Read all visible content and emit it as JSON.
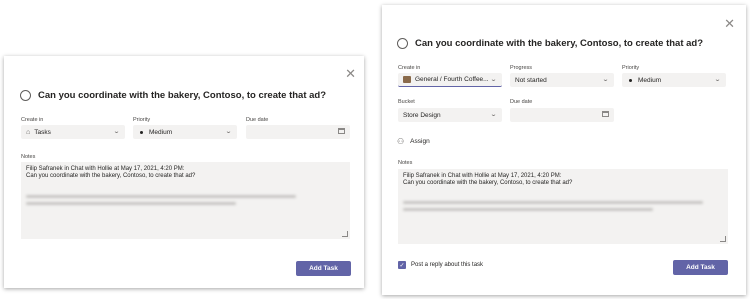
{
  "left_dialog": {
    "close_glyph": "✕",
    "title": "Can you coordinate with the bakery, Contoso, to create that ad?",
    "create_in_label": "Create in",
    "create_in_value": "Tasks",
    "priority_label": "Priority",
    "priority_value": "Medium",
    "due_date_label": "Due date",
    "notes_label": "Notes",
    "notes_line1": "Filip Safranek in Chat with Hollie at May 17, 2021, 4:20 PM:",
    "notes_line2": "Can you coordinate with the bakery, Contoso, to create that ad?",
    "add_task_label": "Add Task"
  },
  "right_dialog": {
    "close_glyph": "✕",
    "title": "Can you coordinate with the bakery, Contoso, to create that ad?",
    "create_in_label": "Create in",
    "create_in_value": "General / Fourth Coffee...",
    "progress_label": "Progress",
    "progress_value": "Not started",
    "priority_label": "Priority",
    "priority_value": "Medium",
    "bucket_label": "Bucket",
    "bucket_value": "Store Design",
    "due_date_label": "Due date",
    "assign_label": "Assign",
    "notes_label": "Notes",
    "notes_line1": "Filip Safranek in Chat with Hollie at May 17, 2021, 4:20 PM:",
    "notes_line2": "Can you coordinate with the bakery, Contoso, to create that ad?",
    "post_reply_label": "Post a reply about this task",
    "add_task_label": "Add Task"
  },
  "colors": {
    "accent": "#6264a7",
    "field_bg": "#f3f2f1"
  }
}
